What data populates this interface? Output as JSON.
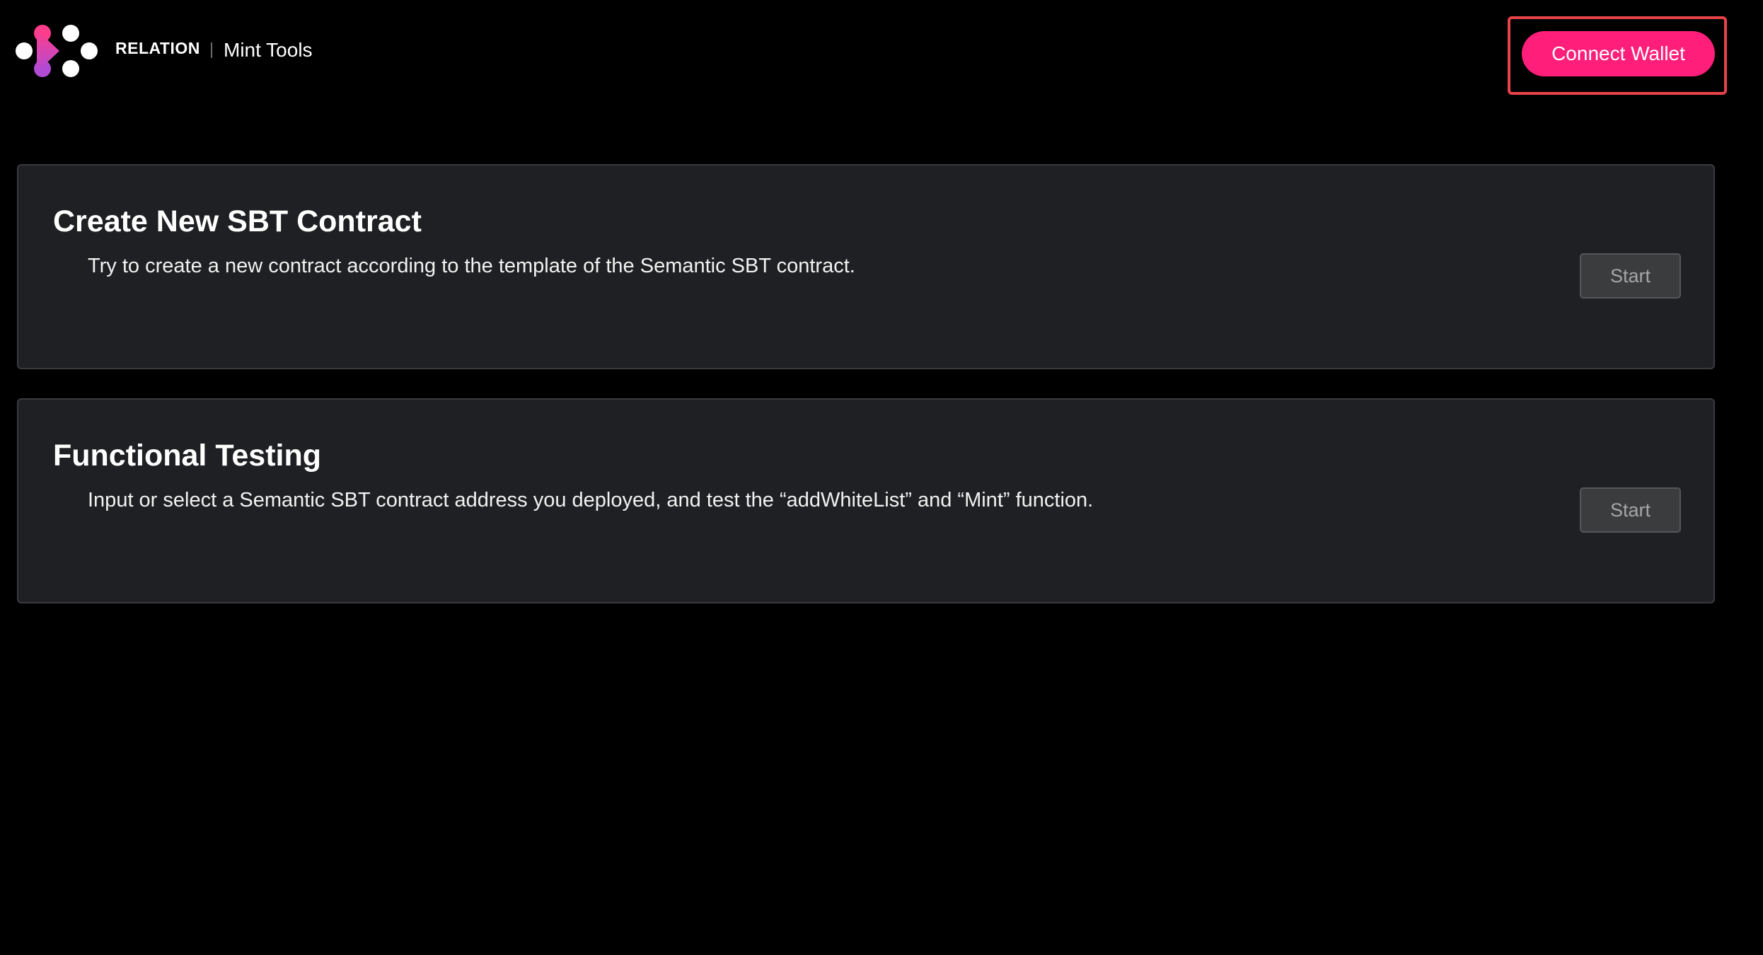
{
  "header": {
    "brand": "RELATION",
    "divider": "|",
    "product": "Mint Tools",
    "logo_icon": "relation-logo-icon",
    "connect_wallet_label": "Connect Wallet"
  },
  "cards": [
    {
      "title": "Create New SBT Contract",
      "description": "Try to create a new contract according to the template of the Semantic SBT contract.",
      "button_label": "Start"
    },
    {
      "title": "Functional Testing",
      "description": "Input or select a Semantic SBT contract address you deployed, and test the “addWhiteList” and “Mint” function.",
      "button_label": "Start"
    }
  ],
  "colors": {
    "background": "#000000",
    "accent": "#ff1f7a",
    "card_background": "#1f2023",
    "highlight_border": "#e8424a",
    "logo_gradient_start": "#ff3d8a",
    "logo_gradient_end": "#b14bd6"
  }
}
